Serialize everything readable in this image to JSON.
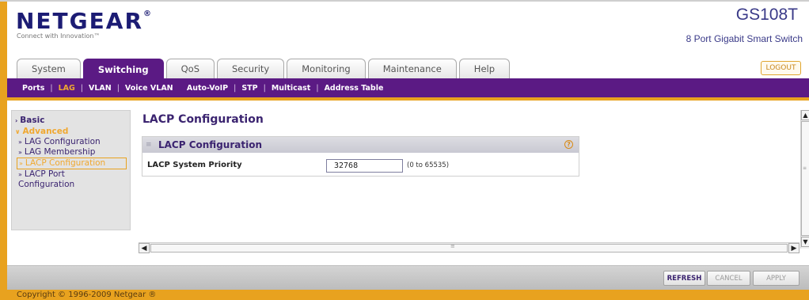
{
  "header": {
    "logo": "NETGEAR",
    "logo_mark": "®",
    "tagline": "Connect with Innovation™",
    "model": "GS108T",
    "model_desc": "8 Port Gigabit Smart Switch",
    "logout_label": "LOGOUT"
  },
  "tabs": [
    {
      "label": "System"
    },
    {
      "label": "Switching",
      "active": true
    },
    {
      "label": "QoS"
    },
    {
      "label": "Security"
    },
    {
      "label": "Monitoring"
    },
    {
      "label": "Maintenance"
    },
    {
      "label": "Help"
    }
  ],
  "subnav": [
    {
      "label": "Ports"
    },
    {
      "label": "LAG",
      "active": true
    },
    {
      "label": "VLAN"
    },
    {
      "label": "Voice VLAN"
    },
    {
      "label": "Auto-VoIP"
    },
    {
      "label": "STP"
    },
    {
      "label": "Multicast"
    },
    {
      "label": "Address Table"
    }
  ],
  "subnav_separator": "|",
  "sidebar": {
    "basic": "Basic",
    "basic_chevron": "›",
    "advanced": "Advanced",
    "advanced_chevron": "∨",
    "bullet": "»",
    "items": [
      {
        "label": "LAG Configuration"
      },
      {
        "label": "LAG Membership"
      },
      {
        "label": "LACP Configuration",
        "active": true
      },
      {
        "label": "LACP Port Configuration"
      }
    ]
  },
  "main": {
    "page_title": "LACP Configuration",
    "panel_title": "LACP Configuration",
    "help_icon": "?",
    "field_label": "LACP System Priority",
    "field_value": "32768",
    "field_hint": "(0 to 65535)"
  },
  "buttons": {
    "refresh": "REFRESH",
    "cancel": "CANCEL",
    "apply": "APPLY"
  },
  "footer": {
    "copyright": "Copyright © 1996-2009 Netgear ®"
  },
  "icons": {
    "scroll_up": "▲",
    "scroll_down": "▼",
    "scroll_left": "◀",
    "scroll_right": "▶",
    "grip": "≡"
  },
  "colors": {
    "brand_purple": "#5b1a84",
    "accent_orange": "#e8a21f",
    "text_navy": "#3b2470"
  }
}
